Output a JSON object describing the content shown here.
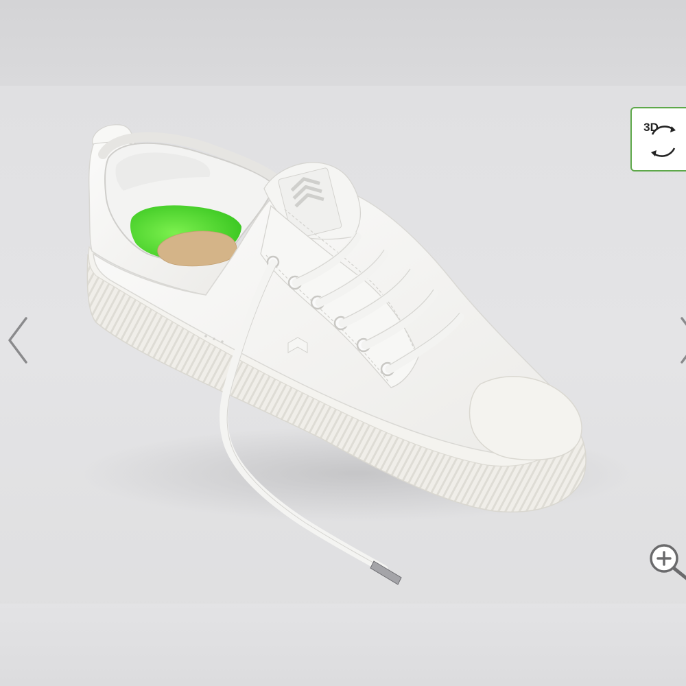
{
  "product_image": {
    "icon": "sneaker-image",
    "brand_mark": "CARIUMA",
    "colors": {
      "leather": "#f6f6f4",
      "insole": "#5fe23a",
      "cork": "#d4b488",
      "sole": "#f1efe9"
    }
  },
  "viewer": {
    "view_3d_label": "3D",
    "view_3d_icon": "rotate-3d-icon",
    "accent_color": "#5ea84a",
    "prev_icon": "chevron-left-icon",
    "next_icon": "chevron-right-icon",
    "zoom_icon": "zoom-in-icon"
  }
}
